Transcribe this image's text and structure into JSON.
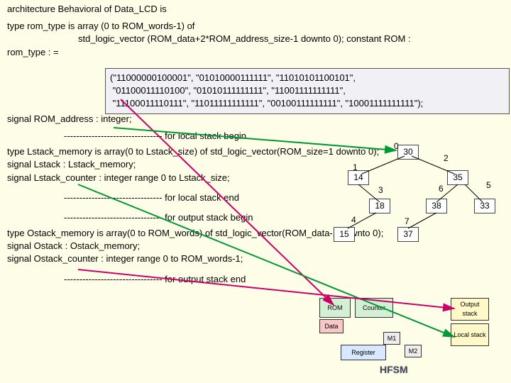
{
  "code": {
    "line1": "architecture Behavioral of Data_LCD is",
    "line2": "type rom_type is array (0 to ROM_words-1) of",
    "line3": "std_logic_vector (ROM_data+2*ROM_address_size-1 downto 0); constant ROM :",
    "line4": "rom_type : =",
    "rom_vals": "(\"11000000100001\", \"01010000111111\", \"11010101100101\",\n \"01100011110100\", \"01010111111111\", \"11001111111111\",\n \"11100011110111\", \"11011111111111\", \"00100111111111\", \"10001111111111\");",
    "signal_rom": "signal ROM_address : integer;",
    "local_begin": "-------------------------------- for local stack begin",
    "lstack1": "type Lstack_memory is array(0 to Lstack_size) of std_logic_vector(ROM_size=1 downto 0);",
    "lstack2": "signal Lstack : Lstack_memory;",
    "lstack3": "signal Lstack_counter : integer range 0 to Lstack_size;",
    "local_end": "-------------------------------- for local stack end",
    "output_begin": "-------------------------------- for output stack begin",
    "ostack1": "type Ostack_memory is array(0 to ROM_words) of std_logic_vector(ROM_data-1 downto 0);",
    "ostack2": "signal Ostack : Ostack_memory;",
    "ostack3": "signal Ostack_counter : integer range 0 to ROM_words-1;",
    "output_end": "-------------------------------- for output stack end"
  },
  "tree": {
    "root": "30",
    "n14": "14",
    "n35": "35",
    "n18": "18",
    "n38": "38",
    "n33": "33",
    "n15": "15",
    "n37": "37",
    "e0": "0",
    "e1": "1",
    "e2": "2",
    "e3": "3",
    "e4": "4",
    "e5": "5",
    "e6": "6",
    "e7": "7"
  },
  "diagram": {
    "rom": "ROM",
    "counter": "Counter",
    "data": "Data",
    "output_stack": "Output stack",
    "local_stack": "Local stack",
    "register": "Register",
    "m1": "M1",
    "m2": "M2",
    "hfsm": "HFSM"
  }
}
